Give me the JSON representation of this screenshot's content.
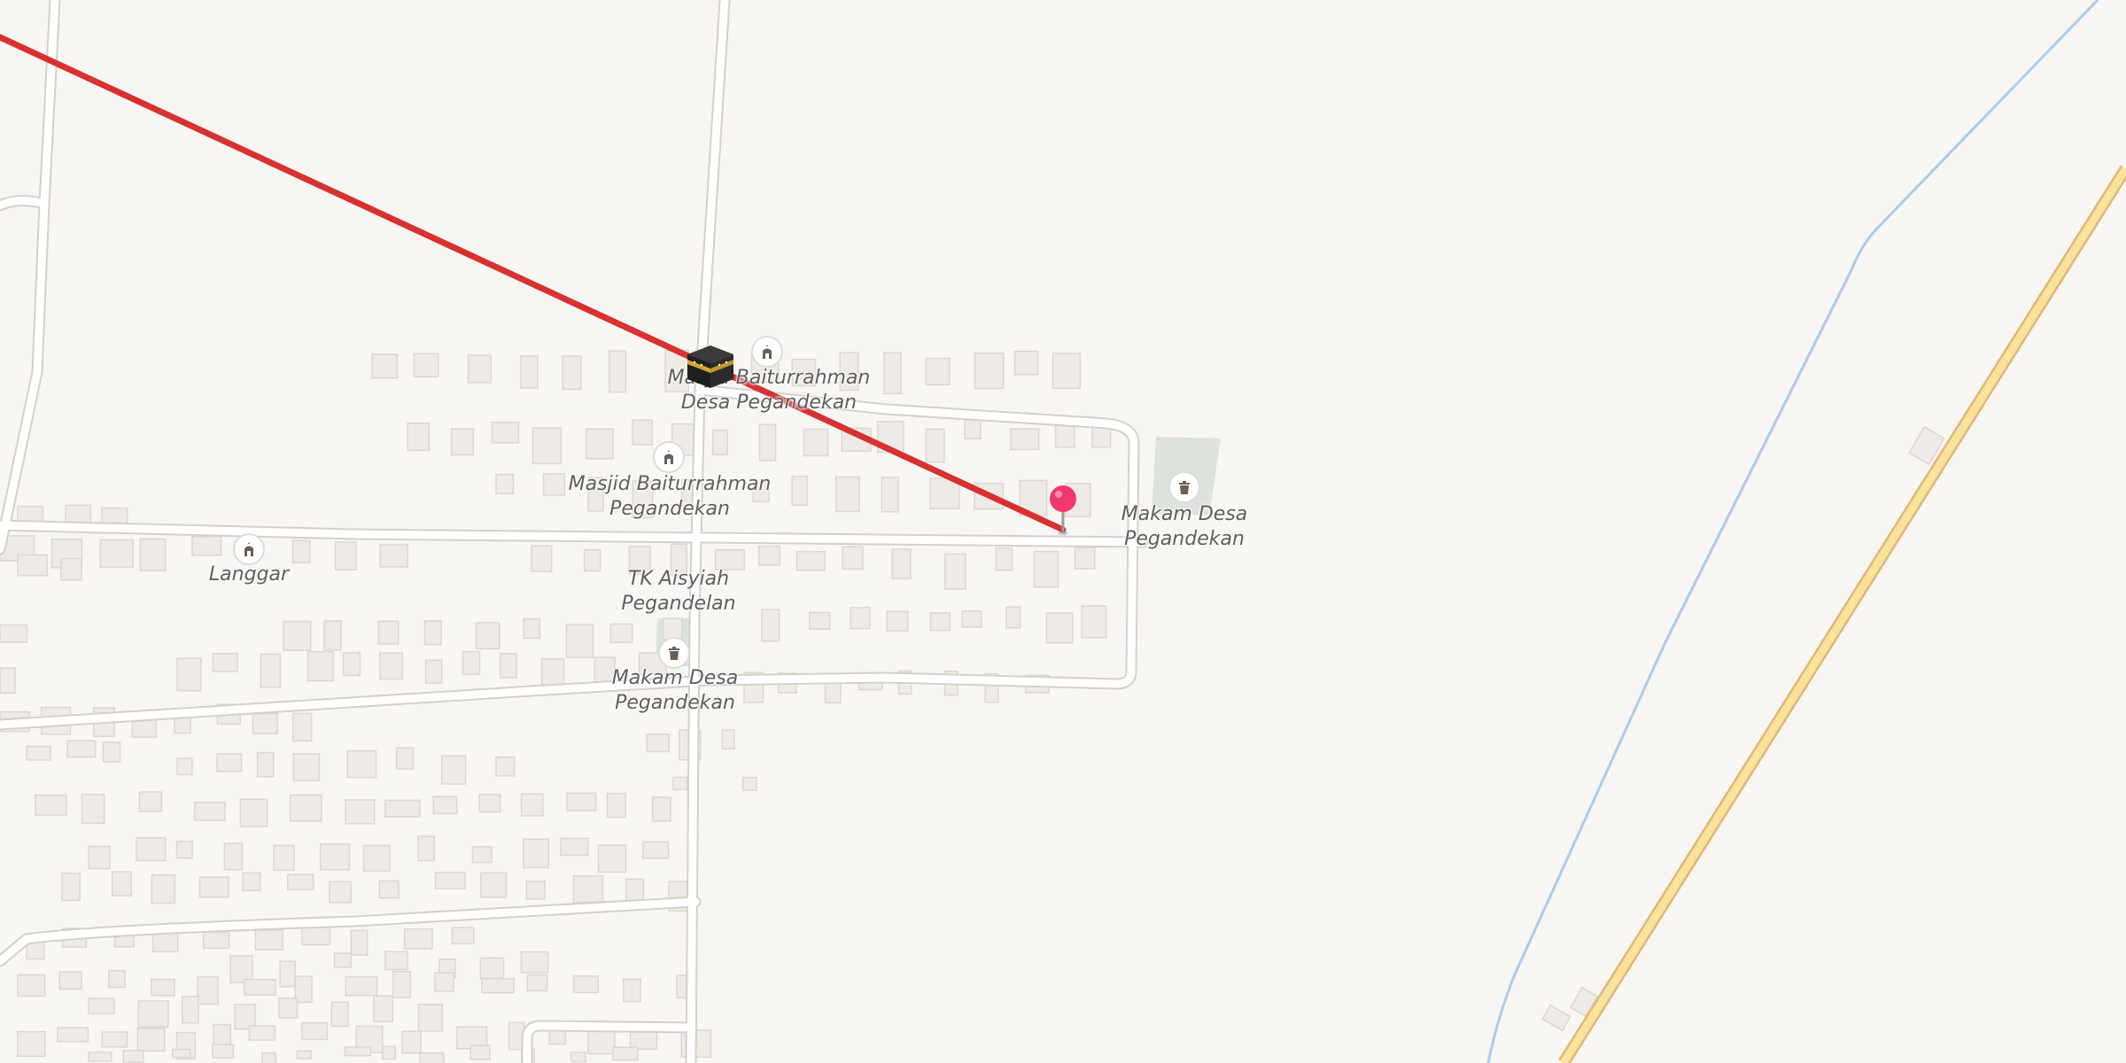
{
  "map": {
    "colors": {
      "background": "#f8f6f3",
      "building": "#eeeae5",
      "building_edge": "#dcd7d1",
      "road_fill": "#ffffff",
      "road_casing": "#d9d5d0",
      "highway_fill": "#fce39a",
      "highway_casing": "#e0b77a",
      "river": "#a8cdf0",
      "qibla_line": "#d8312f",
      "pin": "#f0386e",
      "cemetery_area": "#dde3dc"
    },
    "pois": [
      {
        "id": "masjid-1",
        "kind": "mosque",
        "icon": "mosque-icon",
        "lines": [
          "Masjid Baiturrahman",
          "Desa Pegandekan"
        ]
      },
      {
        "id": "masjid-2",
        "kind": "mosque",
        "icon": "mosque-icon",
        "lines": [
          "Masjid Baiturrahman",
          "Pegandekan"
        ]
      },
      {
        "id": "langgar",
        "kind": "mosque",
        "icon": "mosque-icon",
        "lines": [
          "Langgar"
        ]
      },
      {
        "id": "tk",
        "kind": "school",
        "icon": "",
        "lines": [
          "TK Aisyiah",
          "Pegandelan"
        ]
      },
      {
        "id": "makam-1",
        "kind": "cemetery",
        "icon": "cemetery-icon",
        "lines": [
          "Makam Desa",
          "Pegandekan"
        ]
      },
      {
        "id": "makam-2",
        "kind": "cemetery",
        "icon": "cemetery-icon",
        "lines": [
          "Makam Desa",
          "Pegandekan"
        ]
      }
    ],
    "markers": {
      "location_pin": "location-pin-icon",
      "qibla_marker": "kaaba-icon"
    }
  }
}
